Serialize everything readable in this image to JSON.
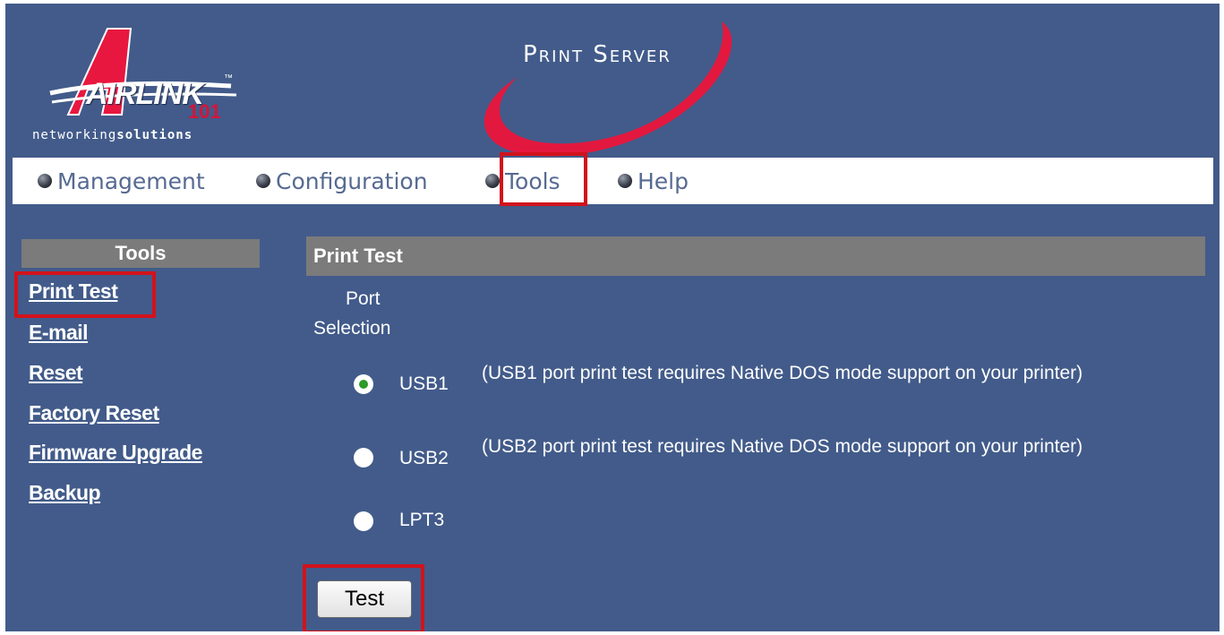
{
  "header": {
    "logo_text": "AIRLINK",
    "logo_tm": "™",
    "logo_number": "101",
    "tagline_light": "networking",
    "tagline_bold": "solutions",
    "product_title": "Print Server"
  },
  "nav": {
    "items": [
      {
        "label": "Management"
      },
      {
        "label": "Configuration"
      },
      {
        "label": "Tools"
      },
      {
        "label": "Help"
      }
    ]
  },
  "sidebar": {
    "title": "Tools",
    "links": [
      {
        "label": "Print Test"
      },
      {
        "label": "E-mail"
      },
      {
        "label": "Reset"
      },
      {
        "label": "Factory Reset"
      },
      {
        "label": "Firmware Upgrade"
      },
      {
        "label": "Backup"
      }
    ]
  },
  "main": {
    "title": "Print Test",
    "port_selection_line1": "Port",
    "port_selection_line2": "Selection",
    "ports": [
      {
        "label": "USB1",
        "description": "(USB1 port print test requires Native DOS mode support on your printer)",
        "selected": true
      },
      {
        "label": "USB2",
        "description": "(USB2 port print test requires Native DOS mode support on your printer)",
        "selected": false
      },
      {
        "label": "LPT3",
        "description": "",
        "selected": false
      }
    ],
    "test_button": "Test"
  },
  "colors": {
    "background": "#425b8a",
    "header_bar": "#7b7b7b",
    "highlight": "#d2121c",
    "logo_red": "#d4153a",
    "nav_text": "#566a92",
    "radio_selected": "#2d9a2a"
  },
  "icons": {
    "nav_bullet": "sphere-bullet-icon",
    "logo_swoosh": "swoosh-icon"
  }
}
